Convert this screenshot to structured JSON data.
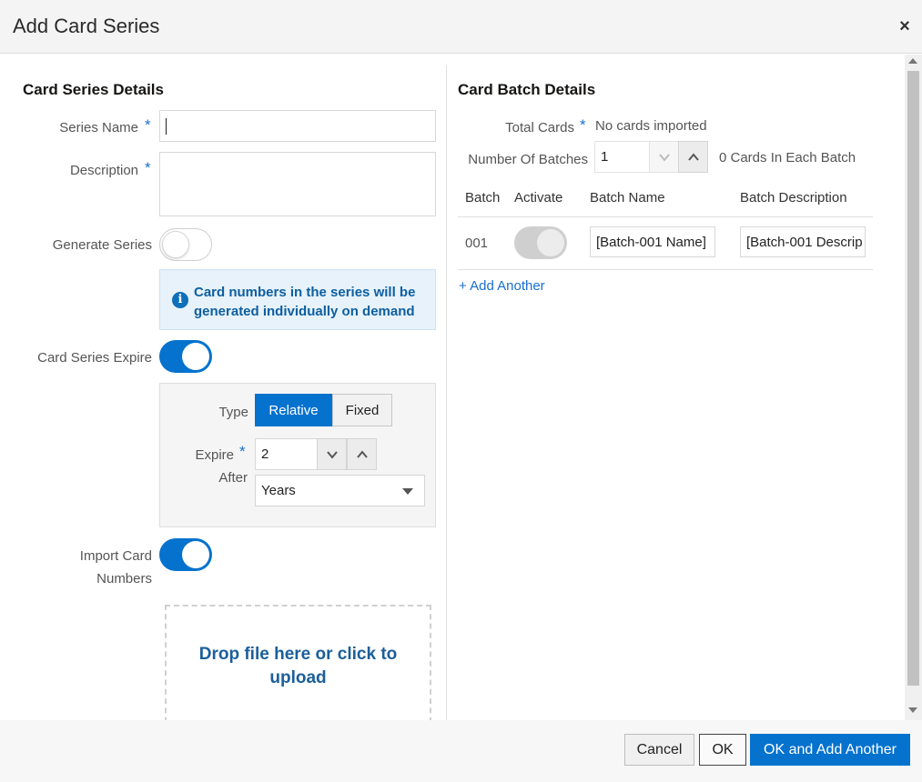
{
  "dialog": {
    "title": "Add Card Series",
    "close_glyph": "×"
  },
  "series": {
    "section_title": "Card Series Details",
    "name_label": "Series Name",
    "name_value": "",
    "description_label": "Description",
    "description_value": "",
    "required_mark": "*",
    "generate_label": "Generate Series",
    "generate_on": false,
    "info_text": "Card numbers in the series will be generated individually on demand",
    "info_glyph": "i",
    "expire_label": "Card Series Expire",
    "expire_on": true,
    "type_label": "Type",
    "type_options": [
      "Relative",
      "Fixed"
    ],
    "type_selected": "Relative",
    "expire_after_label_1": "Expire",
    "expire_after_label_2": "After",
    "expire_after_value": "2",
    "expire_unit": "Years",
    "import_label_1": "Import Card",
    "import_label_2": "Numbers",
    "import_on": true,
    "dropzone_text": "Drop file here or click to upload"
  },
  "batch": {
    "section_title": "Card Batch Details",
    "total_cards_label": "Total Cards",
    "total_cards_value": "No cards imported",
    "num_batches_label": "Number Of Batches",
    "num_batches_value": "1",
    "cards_each_batch": "0 Cards In Each Batch",
    "columns": [
      "Batch",
      "Activate",
      "Batch Name",
      "Batch Description"
    ],
    "rows": [
      {
        "batch": "001",
        "activate": true,
        "name": "[Batch-001 Name]",
        "description": "[Batch-001 Descrip"
      }
    ],
    "add_another": "+ Add Another"
  },
  "footer": {
    "cancel": "Cancel",
    "ok": "OK",
    "ok_add": "OK and Add Another"
  },
  "colors": {
    "accent": "#0572ce",
    "info_bg": "#e7f2fb",
    "info_text": "#0d5fa0"
  }
}
